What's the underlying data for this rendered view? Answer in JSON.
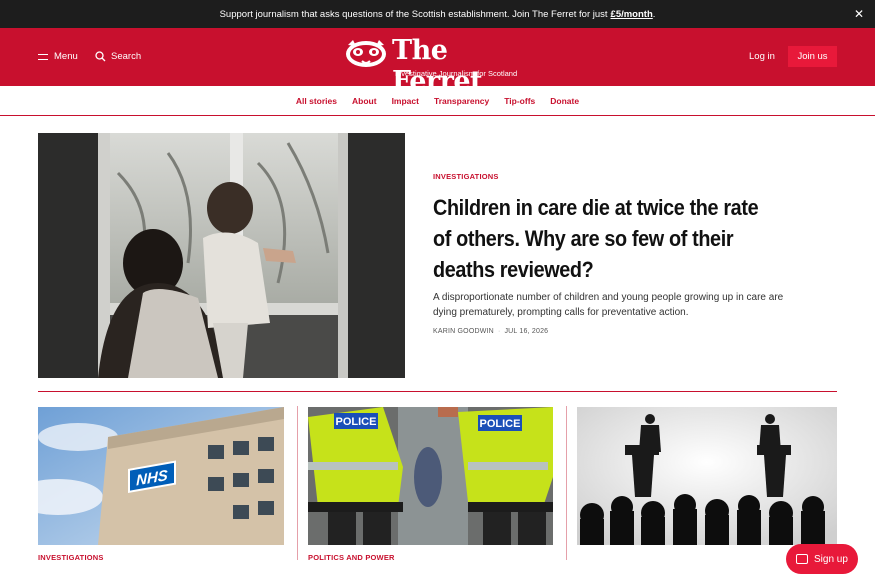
{
  "topbar": {
    "message": "Support journalism that asks questions of the Scottish establishment. Join The Ferret for just",
    "price_link": "£5/month",
    "period": ".",
    "close": "✕"
  },
  "header": {
    "menu_label": "Menu",
    "search_label": "Search",
    "logo_text": "The Ferret",
    "tagline": "Investigative Journalism for Scotland",
    "login_label": "Log in",
    "join_label": "Join us"
  },
  "nav": {
    "items": [
      "All stories",
      "About",
      "Impact",
      "Transparency",
      "Tip-offs",
      "Donate"
    ]
  },
  "hero": {
    "kicker": "INVESTIGATIONS",
    "title": "Children in care die at twice the rate of others. Why are so few of their deaths reviewed?",
    "dek": "A disproportionate number of children and young people growing up in care are dying prematurely, prompting calls for preventative action.",
    "author": "KARIN GOODWIN",
    "date": "JUL 16, 2026"
  },
  "cards": [
    {
      "kicker": "INVESTIGATIONS",
      "image_text": "NHS"
    },
    {
      "kicker": "POLITICS AND POWER",
      "image_text_left": "POLICE",
      "image_text_right": "POLICE"
    },
    {
      "kicker": ""
    }
  ],
  "signup": {
    "label": "Sign up"
  },
  "colors": {
    "brand": "#c8102e",
    "accent": "#e8193a",
    "topbar": "#1d1d1d"
  }
}
